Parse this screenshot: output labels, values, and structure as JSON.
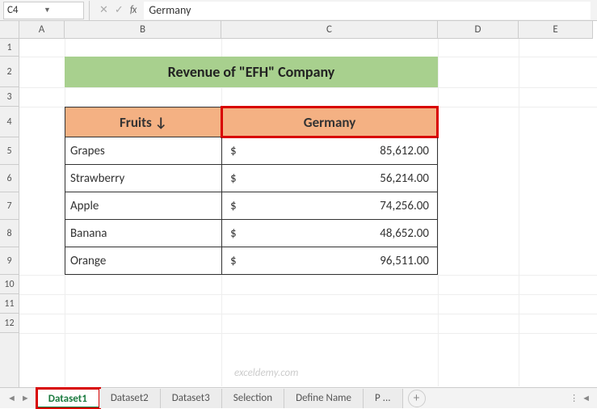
{
  "nameBox": "C4",
  "formulaValue": "Germany",
  "columns": [
    "A",
    "B",
    "C",
    "D",
    "E"
  ],
  "rows": [
    "1",
    "2",
    "3",
    "4",
    "5",
    "6",
    "7",
    "8",
    "9",
    "10",
    "11",
    "12"
  ],
  "title": "Revenue of \"EFH\" Company",
  "headers": {
    "b": "Fruits ↓",
    "c": "Germany"
  },
  "currency": "$",
  "data": [
    {
      "fruit": "Grapes",
      "value": "85,612.00"
    },
    {
      "fruit": "Strawberry",
      "value": "56,214.00"
    },
    {
      "fruit": "Apple",
      "value": "74,256.00"
    },
    {
      "fruit": "Banana",
      "value": "48,652.00"
    },
    {
      "fruit": "Orange",
      "value": "96,511.00"
    }
  ],
  "tabs": [
    "Dataset1",
    "Dataset2",
    "Dataset3",
    "Selection",
    "Define Name",
    "P ..."
  ],
  "activeTab": 0,
  "watermark": "exceldemy.com"
}
